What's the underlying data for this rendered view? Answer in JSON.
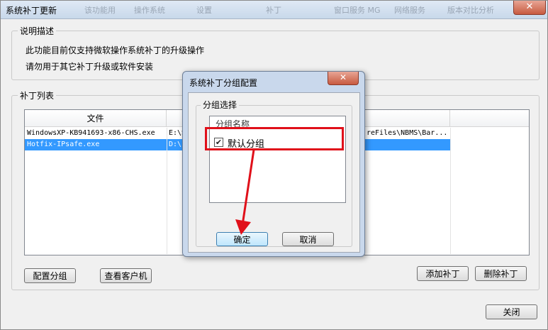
{
  "window": {
    "title": "系统补丁更新",
    "close_glyph": "✕"
  },
  "background_tabs": [
    "该功能用",
    "操作系统",
    "设置",
    "补丁",
    "窗口服务 MG",
    "网络服务",
    "版本对比分析"
  ],
  "description": {
    "title": "说明描述",
    "line1": "此功能目前仅支持微软操作系统补丁的升级操作",
    "line2": "请勿用于其它补丁升级或软件安装"
  },
  "patch_list": {
    "title": "补丁列表",
    "columns": [
      "文件",
      "",
      ""
    ],
    "rows": [
      {
        "file": "WindowsXP-KB941693-x86-CHS.exe",
        "path": "E:\\S",
        "path_tail": "reFiles\\NBMS\\Bar..."
      },
      {
        "file": "Hotfix-IPsafe.exe",
        "path": "D:\\",
        "path_tail": ""
      }
    ]
  },
  "buttons": {
    "config_group": "配置分组",
    "view_clients": "查看客户机",
    "add_patch": "添加补丁",
    "delete_patch": "删除补丁",
    "close": "关闭"
  },
  "dialog": {
    "title": "系统补丁分组配置",
    "close_glyph": "✕",
    "group_box_title": "分组选择",
    "column_header": "分组名称",
    "items": [
      {
        "label": "默认分组",
        "checked": true
      }
    ],
    "ok": "确定",
    "cancel": "取消"
  },
  "colors": {
    "annotation": "#e0101a",
    "selection": "#3399ff"
  }
}
